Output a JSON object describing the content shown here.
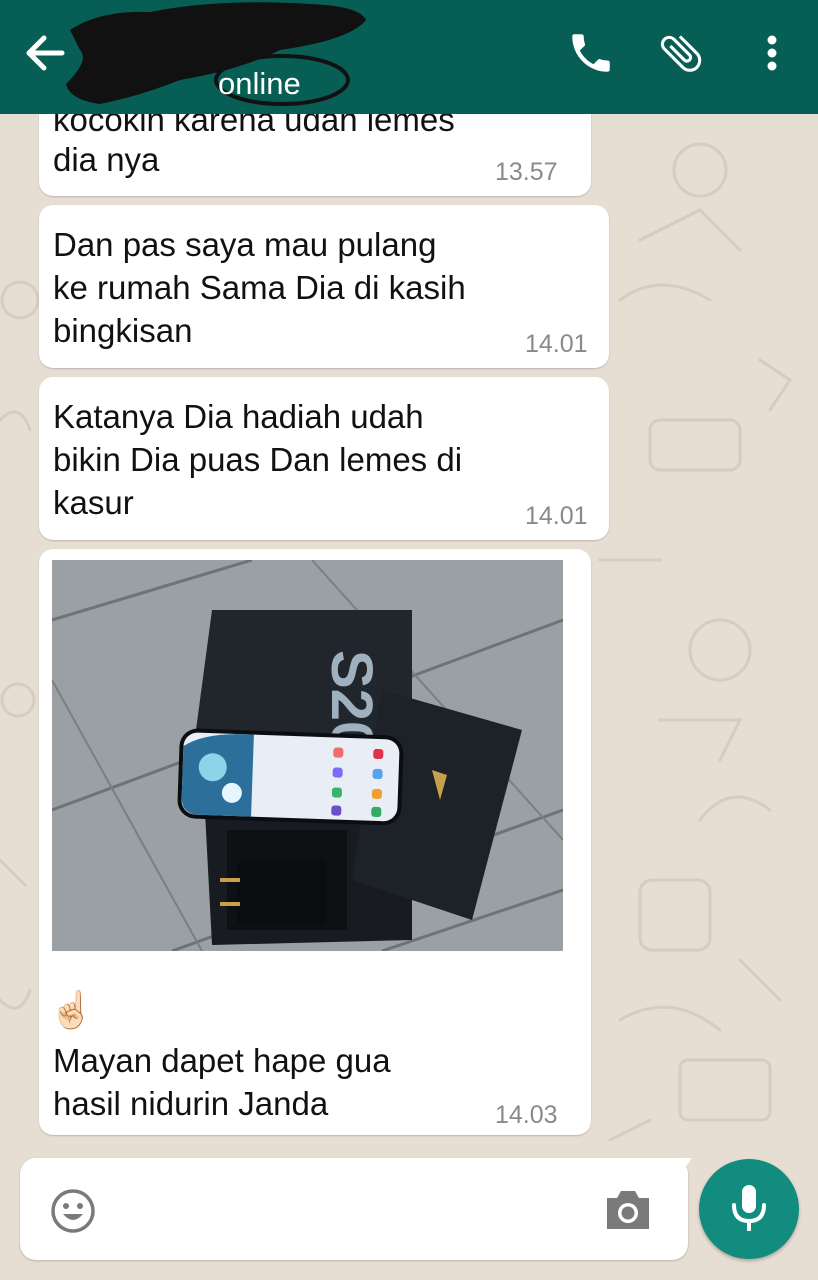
{
  "header": {
    "status": "online",
    "icons": [
      "back-arrow-icon",
      "phone-icon",
      "paperclip-icon",
      "more-vert-icon"
    ],
    "background_color": "#075e54"
  },
  "messages": [
    {
      "text_partial": "kocokin karena udah lemes",
      "text": "dia nya",
      "time": "13.57"
    },
    {
      "text": "Dan pas saya mau pulang\nke rumah Sama Dia di kasih\nbingkisan",
      "time": "14.01"
    },
    {
      "text": "Katanya Dia hadiah udah\nbikin Dia puas Dan lemes di\nkasur",
      "time": "14.01"
    },
    {
      "image": "photo of a Samsung S20 phone with box and charger on tiled floor",
      "box_label": "S20",
      "emoji": "☝🏻",
      "text": "Mayan dapet hape gua\nhasil nidurin Janda",
      "time": "14.03"
    }
  ],
  "composer": {
    "emoji_icon": "emoji-icon",
    "camera_icon": "camera-icon",
    "mic_icon": "mic-icon",
    "accent_color": "#128c7e"
  }
}
